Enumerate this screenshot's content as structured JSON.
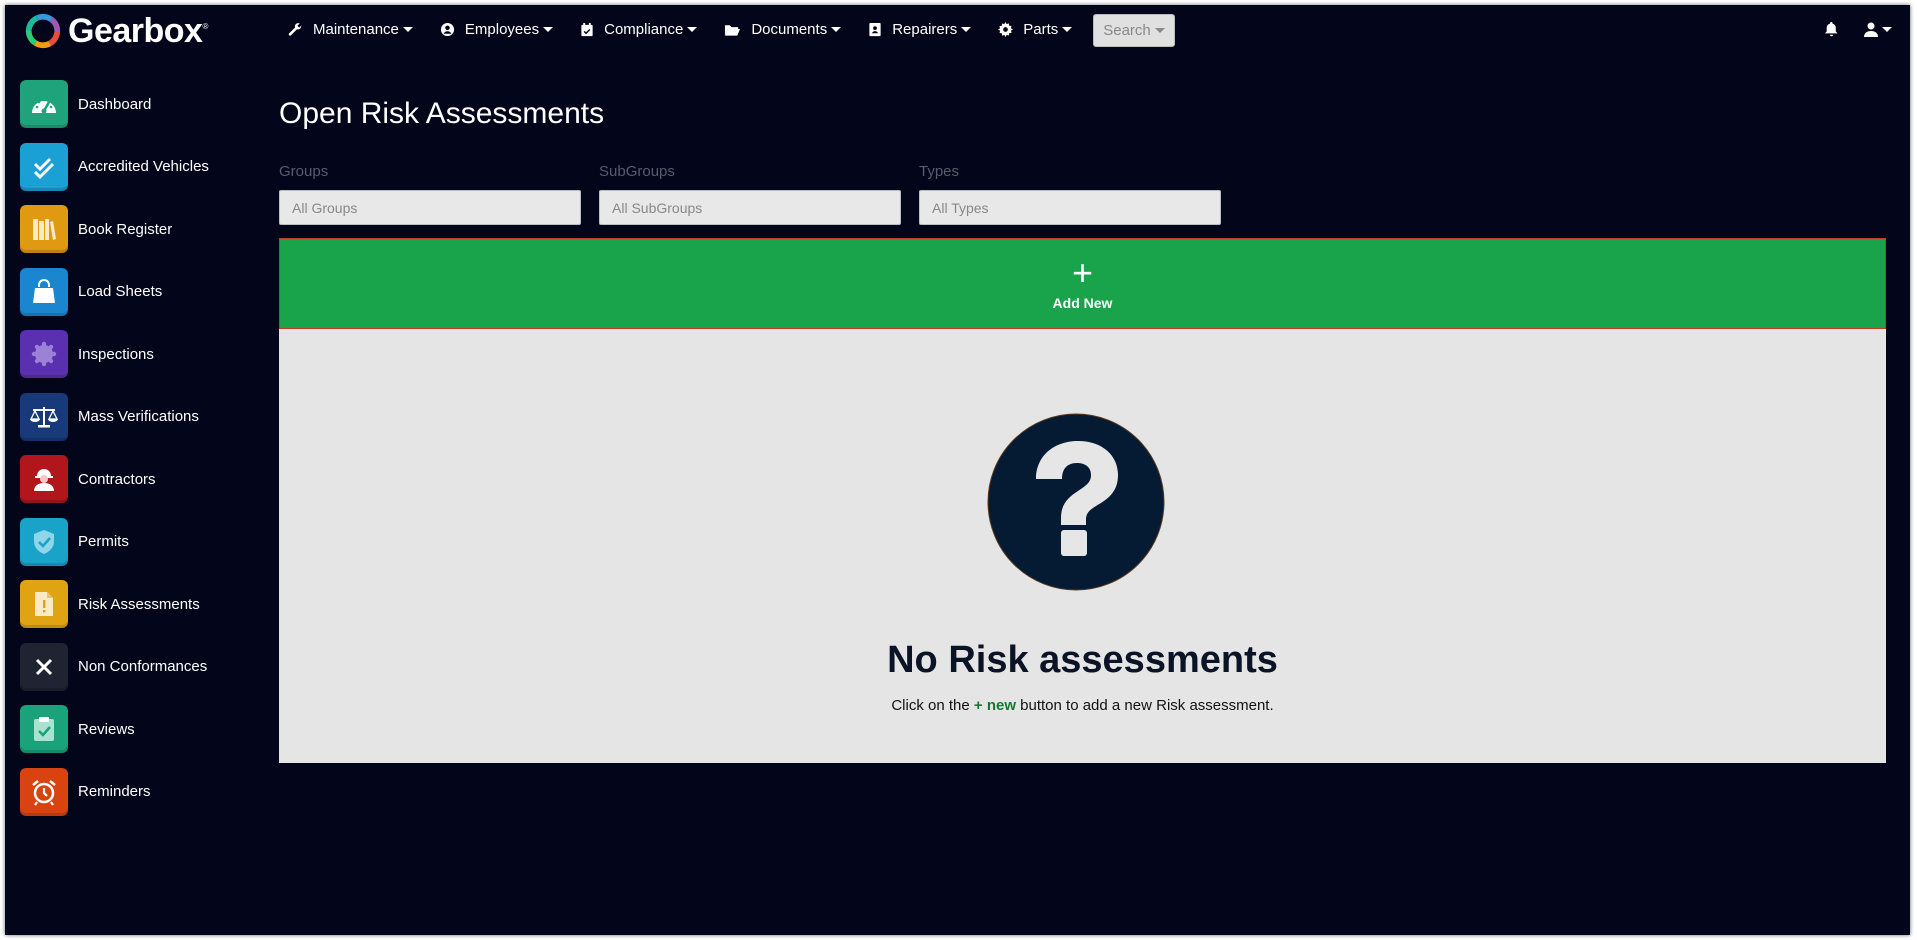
{
  "brand": {
    "name": "Gearbox",
    "tm": "®"
  },
  "nav": {
    "items": [
      {
        "label": "Maintenance",
        "icon": "wrench-icon"
      },
      {
        "label": "Employees",
        "icon": "user-circle-icon"
      },
      {
        "label": "Compliance",
        "icon": "calendar-check-icon"
      },
      {
        "label": "Documents",
        "icon": "folder-open-icon"
      },
      {
        "label": "Repairers",
        "icon": "address-card-icon"
      },
      {
        "label": "Parts",
        "icon": "gear-icon"
      }
    ],
    "search_label": "Search"
  },
  "sidebar": {
    "items": [
      {
        "label": "Dashboard",
        "color": "#1fa37a",
        "icon": "gauge-icon"
      },
      {
        "label": "Accredited Vehicles",
        "color": "#1ba0d6",
        "icon": "double-check-icon"
      },
      {
        "label": "Book Register",
        "color": "#e09a12",
        "icon": "books-icon"
      },
      {
        "label": "Load Sheets",
        "color": "#1a86d0",
        "icon": "bag-icon"
      },
      {
        "label": "Inspections",
        "color": "#5a2fb0",
        "icon": "badge-icon"
      },
      {
        "label": "Mass Verifications",
        "color": "#18397a",
        "icon": "scales-icon"
      },
      {
        "label": "Contractors",
        "color": "#b0161b",
        "icon": "hardhat-worker-icon"
      },
      {
        "label": "Permits",
        "color": "#1aa3c9",
        "icon": "shield-check-icon"
      },
      {
        "label": "Risk Assessments",
        "color": "#e0a412",
        "icon": "file-exclamation-icon"
      },
      {
        "label": "Non Conformances",
        "color": "#1f2433",
        "icon": "x-icon"
      },
      {
        "label": "Reviews",
        "color": "#1aa37a",
        "icon": "clipboard-check-icon"
      },
      {
        "label": "Reminders",
        "color": "#d8430f",
        "icon": "alarm-clock-icon"
      }
    ]
  },
  "main": {
    "title": "Open Risk Assessments",
    "filters": [
      {
        "label": "Groups",
        "placeholder": "All Groups"
      },
      {
        "label": "SubGroups",
        "placeholder": "All SubGroups"
      },
      {
        "label": "Types",
        "placeholder": "All Types"
      }
    ],
    "add_new": {
      "plus": "+",
      "label": "Add New"
    },
    "empty": {
      "title": "No Risk assessments",
      "sub_before": "Click on the ",
      "sub_link": "+ new",
      "sub_after": " button to add a new Risk assessment."
    }
  }
}
